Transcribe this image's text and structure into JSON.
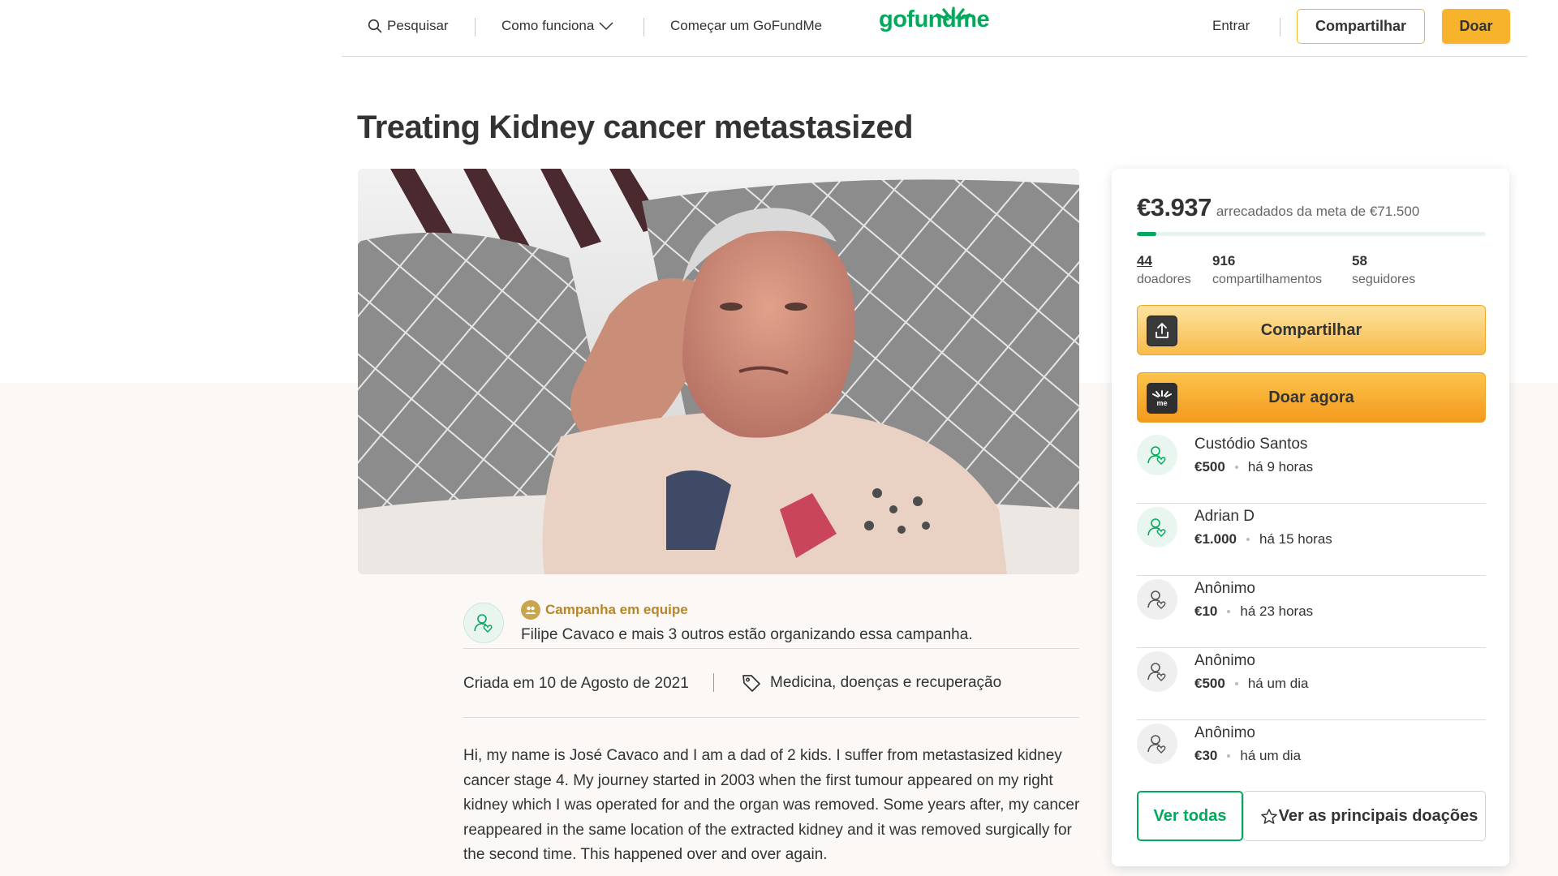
{
  "nav": {
    "search_label": "Pesquisar",
    "how_it_works_label": "Como funciona",
    "start_label": "Começar um GoFundMe",
    "logo_text": "gofundme",
    "signin_label": "Entrar",
    "share_label": "Compartilhar",
    "donate_label": "Doar"
  },
  "campaign": {
    "title": "Treating Kidney cancer metastasized",
    "photo_icon": "campaign-photo"
  },
  "organizer": {
    "team_label": "Campanha em equipe",
    "text": "Filipe Cavaco e mais 3 outros estão organizando essa campanha."
  },
  "meta": {
    "created": "Criada em 10 de Agosto de 2021",
    "category": "Medicina, doenças e recuperação"
  },
  "story": {
    "text": "Hi, my name is José Cavaco and I am a dad of 2 kids. I suffer from metastasized kidney cancer stage 4. My journey started in 2003 when the first tumour appeared on my right kidney which I was operated for and the organ was removed. Some years after, my cancer reappeared in the same location of the extracted kidney and it was removed surgically for the second time. This happened over and over again."
  },
  "sidebar": {
    "raised_amount": "€3.937",
    "goal_text": "arrecadados da meta de €71.500",
    "progress_fraction": 0.055,
    "stats": [
      {
        "value": "44",
        "label": "doadores"
      },
      {
        "value": "916",
        "label": "compartilhamentos"
      },
      {
        "value": "58",
        "label": "seguidores"
      }
    ],
    "share_button": "Compartilhar",
    "donate_button": "Doar agora",
    "donations": [
      {
        "name": "Custódio Santos",
        "amount": "€500",
        "time": "há 9 horas",
        "style": "green"
      },
      {
        "name": "Adrian D",
        "amount": "€1.000",
        "time": "há 15 horas",
        "style": "green"
      },
      {
        "name": "Anônimo",
        "amount": "€10",
        "time": "há 23 horas",
        "style": "grey"
      },
      {
        "name": "Anônimo",
        "amount": "€500",
        "time": "há um dia",
        "style": "grey"
      },
      {
        "name": "Anônimo",
        "amount": "€30",
        "time": "há um dia",
        "style": "grey"
      }
    ],
    "see_all_button": "Ver todas",
    "top_donations_button": "Ver as principais doações"
  },
  "colors": {
    "brand_green": "#02a95c",
    "accent_yellow": "#f7b32b",
    "team_gold": "#b8862a"
  }
}
